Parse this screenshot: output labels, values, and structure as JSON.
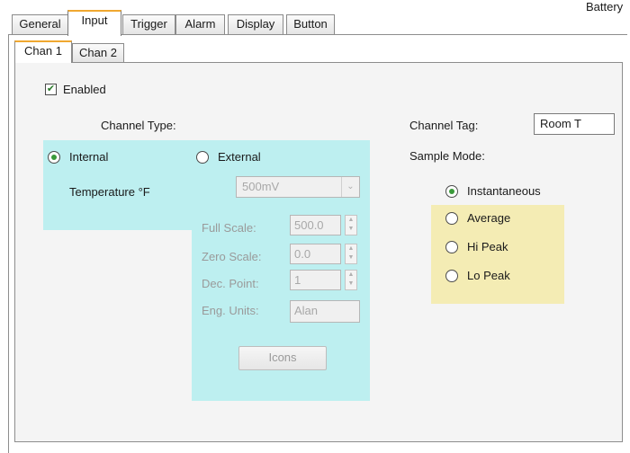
{
  "top_tabs": [
    "General",
    "Input",
    "Trigger",
    "Alarm",
    "Display",
    "Button"
  ],
  "battery_label": "Battery",
  "sub_tabs": [
    "Chan 1",
    "Chan 2"
  ],
  "enabled": {
    "label": "Enabled",
    "checked": true
  },
  "channel_type": {
    "heading": "Channel Type:",
    "internal": {
      "label": "Internal",
      "selected": true,
      "sensor": "Temperature °F"
    },
    "external": {
      "label": "External",
      "selected": false,
      "range_select": "500mV",
      "full_scale": {
        "label": "Full Scale:",
        "value": "500.0"
      },
      "zero_scale": {
        "label": "Zero Scale:",
        "value": "0.0"
      },
      "dec_point": {
        "label": "Dec. Point:",
        "value": "1"
      },
      "eng_units": {
        "label": "Eng. Units:",
        "value": "Alan"
      },
      "icons_button": "Icons"
    }
  },
  "channel_tag": {
    "label": "Channel Tag:",
    "value": "Room T"
  },
  "sample_mode": {
    "label": "Sample Mode:",
    "options": [
      "Instantaneous",
      "Average",
      "Hi Peak",
      "Lo Peak"
    ],
    "selected": "Instantaneous"
  },
  "colors": {
    "cyan_panel": "#bdeff0",
    "yellow_panel": "#f4ecb4",
    "tab_accent": "#f0a830",
    "radio_dot": "#3a9a3a"
  }
}
